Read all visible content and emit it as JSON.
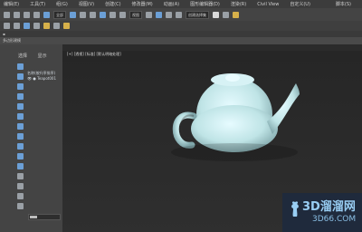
{
  "menubar": {
    "items": [
      "编辑(E)",
      "工具(T)",
      "组(G)",
      "视图(V)",
      "创建(C)",
      "修改器(M)",
      "动画(A)",
      "图形编辑器(D)",
      "渲染(R)",
      "Civil View",
      "自定义(U)"
    ],
    "right": "脚本(S)"
  },
  "toolbar": {
    "selection_filter": "全部",
    "view_mode": "视图",
    "named_sets": "创建选择集"
  },
  "strip": {
    "label": "多边形建模"
  },
  "left_panel": {
    "tabs": [
      "选择",
      "显示"
    ],
    "scene_header": "名称(按升序排序)",
    "scene_item": "Teapot001"
  },
  "viewport": {
    "label": "[+] [透视] [标准] [默认明暗处理]"
  },
  "watermark": {
    "line1": "3D溜溜网",
    "line2": "3D66.COM"
  },
  "colors": {
    "accent": "#6b9fd6",
    "teapot": "#bfe4e6"
  }
}
